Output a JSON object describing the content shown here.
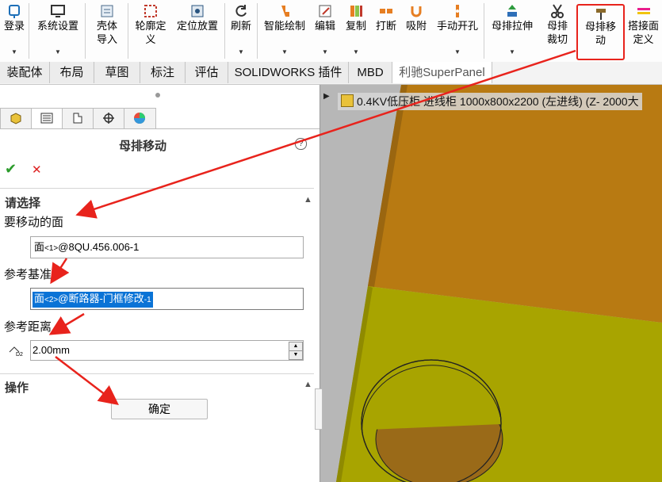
{
  "toolbar": {
    "items": [
      {
        "label": "登录",
        "icon": "power-plug-icon"
      },
      {
        "label": "系统设置",
        "icon": "monitor-settings-icon"
      },
      {
        "label": "壳体导入",
        "icon": "import-icon"
      },
      {
        "label": "轮廓定义",
        "icon": "profile-icon"
      },
      {
        "label": "定位放置",
        "icon": "place-icon"
      },
      {
        "label": "刷新",
        "icon": "refresh-icon"
      },
      {
        "label": "智能绘制",
        "icon": "smart-draw-icon"
      },
      {
        "label": "编辑",
        "icon": "edit-icon"
      },
      {
        "label": "复制",
        "icon": "copy-icon"
      },
      {
        "label": "打断",
        "icon": "break-icon"
      },
      {
        "label": "吸附",
        "icon": "magnet-icon"
      },
      {
        "label": "手动开孔",
        "icon": "drill-icon"
      },
      {
        "label": "母排拉伸",
        "icon": "stretch-icon"
      },
      {
        "label": "母排裁切",
        "icon": "scissors-icon"
      },
      {
        "label": "母排移动",
        "icon": "busbar-move-icon"
      },
      {
        "label": "搭接面定义",
        "icon": "lap-face-icon"
      }
    ]
  },
  "tabs": [
    "装配体",
    "布局",
    "草图",
    "标注",
    "评估",
    "SOLIDWORKS 插件",
    "MBD",
    "利驰SuperPanel"
  ],
  "panel": {
    "title": "母排移动",
    "section_select": "请选择",
    "face_label": "要移动的面",
    "face_value_prefix": "面",
    "face_value_index": "<1>",
    "face_value_rest": "@8QU.456.006-1",
    "ref_label": "参考基准",
    "ref_value_prefix": "面",
    "ref_value_index": "<2>",
    "ref_value_rest": "@断路器-门框修改",
    "ref_value_suffix": "-1",
    "distance_label": "参考距离",
    "distance_value": "2.00mm",
    "distance_icon_text": "D2",
    "section_ops": "操作",
    "confirm": "确定"
  },
  "viewport": {
    "title": "0.4KV低压柜 进线柜 1000x800x2200 (左进线)  (Z- 2000大"
  },
  "colors": {
    "highlight": "#0a73d6",
    "annotation_red": "#e8231c",
    "panel_orange": "#b87a12",
    "plate_olive": "#a8a400",
    "hole_inner": "#9a6a18"
  }
}
